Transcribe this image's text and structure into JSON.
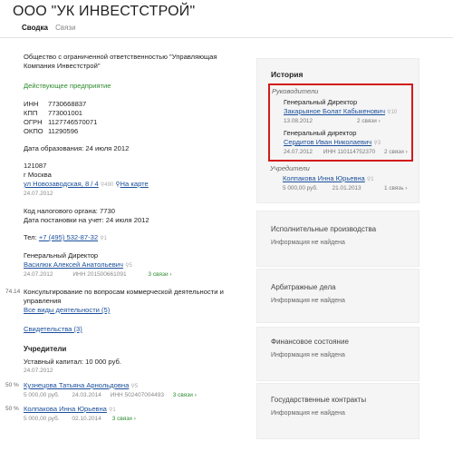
{
  "header": {
    "title": "ООО \"УК ИНВЕСТСТРОЙ\"",
    "tab_active": "Сводка",
    "tab_other": "Связи"
  },
  "left": {
    "fullname": "Общество с ограниченной ответственностью \"Управляющая Компания Инвестстрой\"",
    "status": "Действующее предприятие",
    "codes": [
      {
        "k": "ИНН",
        "v": "7730668837"
      },
      {
        "k": "КПП",
        "v": "773001001"
      },
      {
        "k": "ОГРН",
        "v": "1127746570071"
      },
      {
        "k": "ОКПО",
        "v": "11290596"
      }
    ],
    "formed": "Дата образования: 24 июля 2012",
    "zip": "121087",
    "city": "г Москва",
    "street": "ул Новозаводская, 8 / 4",
    "street_cnt": "490",
    "map_link": "На карте",
    "addr_date": "24.07.2012",
    "tax_code": "Код налогового органа: 7730",
    "tax_date": "Дата постановки на учет: 24 июля 2012",
    "tel_label": "Тел:",
    "tel": "+7 (495) 532-87-32",
    "tel_cnt": "1",
    "dir_role": "Генеральный Директор",
    "dir_name": "Василюк Алексей Анатольевич",
    "dir_cnt": "5",
    "dir_date": "24.07.2012",
    "dir_inn": "ИНН 201500661091",
    "dir_links": "3 связи",
    "okved_code": "74.14",
    "okved_text": "Консультирование по вопросам коммерческой деятельности и управления",
    "all_acts": "Все виды деятельности (5)",
    "certs": "Свидетельства (3)",
    "founders_title": "Учредители",
    "capital": "Уставный капитал: 10 000 руб.",
    "capital_date": "24.07.2012",
    "founders": [
      {
        "pct": "50 %",
        "name": "Кузнецова Татьяна Арнольдовна",
        "cnt": "5",
        "sum": "5 000,00 руб.",
        "date": "24.03.2014",
        "inn": "ИНН 502407004493",
        "links": "3 связи"
      },
      {
        "pct": "50 %",
        "name": "Колпакова Инна Юрьевна",
        "cnt": "1",
        "sum": "5 000,00 руб.",
        "date": "02.10.2014",
        "inn": "",
        "links": "3 связи"
      }
    ]
  },
  "history": {
    "title": "История",
    "managers_label": "Руководители",
    "m1_role": "Генеральный Директор",
    "m1_name": "Закарьяное Болат Кабыкенович",
    "m1_cnt": "10",
    "m1_date": "13.08.2012",
    "m1_links": "2 связи",
    "m2_role": "Генеральный директор",
    "m2_name": "Сердитов Иван Николаевич",
    "m2_cnt": "3",
    "m2_date": "24.07.2012",
    "m2_inn": "ИНН 110114752370",
    "m2_links": "2 связи",
    "founders_label": "Учредители",
    "f1_name": "Колпакова Инна Юрьевна",
    "f1_cnt": "1",
    "f1_sum": "5 000,00 руб.",
    "f1_date": "21.01.2013",
    "f1_links": "1 связь"
  },
  "panels": [
    {
      "title": "Исполнительные производства",
      "sub": "Информация не найдена"
    },
    {
      "title": "Арбитражные дела",
      "sub": "Информация не найдена"
    },
    {
      "title": "Финансовое состояние",
      "sub": "Информация не найдена"
    },
    {
      "title": "Государственные контракты",
      "sub": "Информация не найдена"
    }
  ],
  "colors": {
    "link": "#1a4f9c",
    "status": "#2e8b2e",
    "highlight": "#d31a1a",
    "panel_bg": "#f5f5f5"
  }
}
